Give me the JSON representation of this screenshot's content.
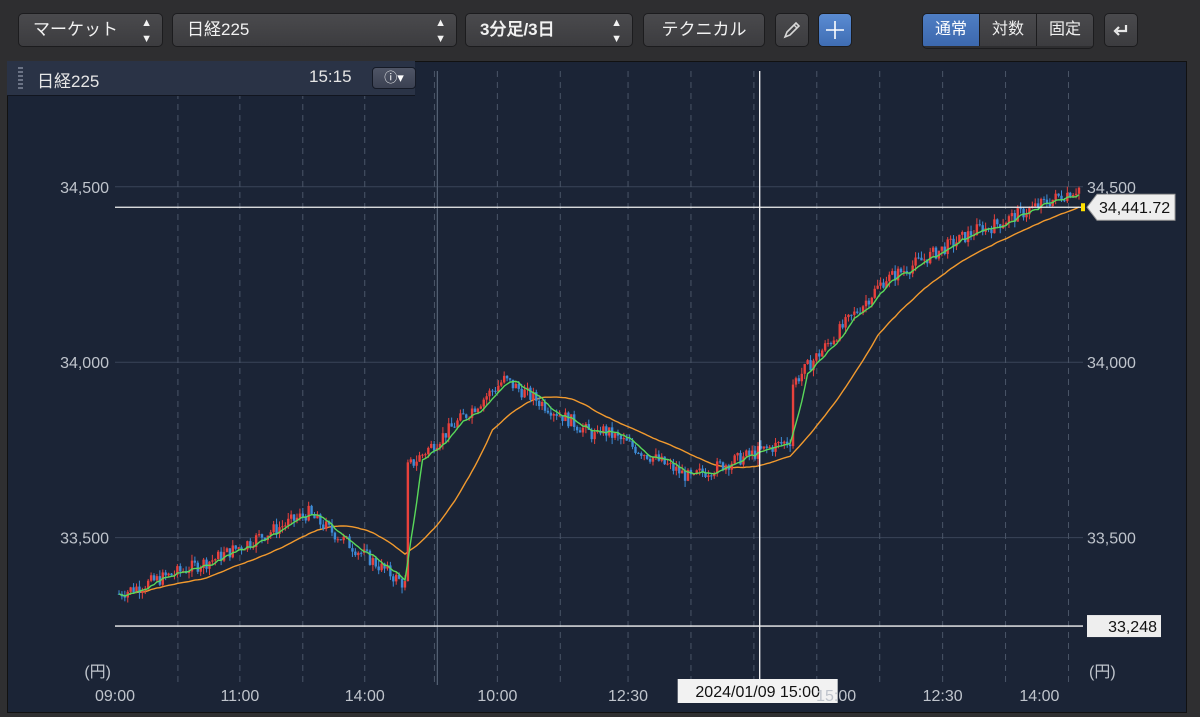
{
  "toolbar": {
    "market_label": "マーケット",
    "symbol_label": "日経225",
    "interval_label": "3分足/3日",
    "technical_label": "テクニカル",
    "scale_modes": [
      "通常",
      "対数",
      "固定"
    ],
    "active_scale_mode": "通常",
    "icons": [
      "updown-arrows-icon",
      "pencil-icon",
      "crosshair-icon",
      "undo-arrow-icon"
    ]
  },
  "legend": {
    "symbol": "日経225",
    "time": "15:15",
    "info_icon": "info-icon"
  },
  "chart_data": {
    "type": "candlestick",
    "x_tick_labels": [
      "09:00",
      "11:00",
      "14:00",
      "10:00",
      "12:30",
      "15:00",
      "12:30",
      "14:00"
    ],
    "y_ticks": [
      34500,
      34000,
      33500
    ],
    "y_tick_labels": [
      "34,500",
      "34,000",
      "33,500"
    ],
    "y_unit": "(円)",
    "ylim": [
      33080,
      34830
    ],
    "crosshair_date_label": "2024/01/09 15:00",
    "high_line": 34441.72,
    "high_label": "34,441.72",
    "low_line": 33248,
    "low_label": "33,248",
    "colors": {
      "up": "#e8413c",
      "down": "#3d8bd6",
      "ma_short": "#59d95a",
      "ma_long": "#f29a2e",
      "bg": "#1b2436"
    },
    "sessions": [
      {
        "open": 33340,
        "close": 33440
      },
      {
        "open": 33440,
        "close": 33575
      },
      {
        "open": 33560,
        "close": 33360
      },
      {
        "open": 33700,
        "close": 33950
      },
      {
        "open": 33950,
        "close": 33780
      },
      {
        "open": 33810,
        "close": 33660
      },
      {
        "open": 33680,
        "close": 33780
      },
      {
        "open": 33940,
        "close": 34250
      },
      {
        "open": 34240,
        "close": 34390
      },
      {
        "open": 34380,
        "close": 34500
      }
    ]
  }
}
